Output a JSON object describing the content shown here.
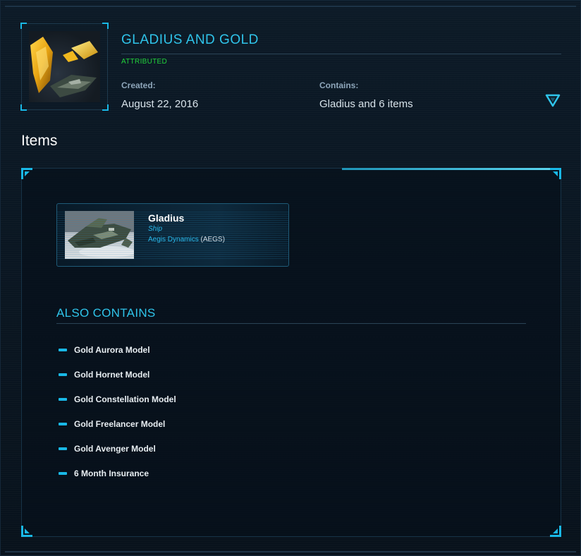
{
  "pledge": {
    "title": "GLADIUS AND GOLD",
    "status": "ATTRIBUTED",
    "created_label": "Created:",
    "created_value": "August 22, 2016",
    "contains_label": "Contains:",
    "contains_value": "Gladius and 6 items"
  },
  "items_heading": "Items",
  "ship": {
    "name": "Gladius",
    "type": "Ship",
    "manufacturer": "Aegis Dynamics",
    "manufacturer_code": "(AEGS)"
  },
  "also_contains": {
    "heading": "ALSO CONTAINS",
    "items": [
      "Gold Aurora Model",
      "Gold Hornet Model",
      "Gold Constellation Model",
      "Gold Freelancer Model",
      "Gold Avenger Model",
      "6 Month Insurance"
    ]
  },
  "colors": {
    "accent": "#2fc4ea",
    "status_green": "#21d13a",
    "background": "#0a1520"
  },
  "icons": {
    "expand": "chevron-down-triangle-icon",
    "bullet": "dash-bullet-icon"
  }
}
